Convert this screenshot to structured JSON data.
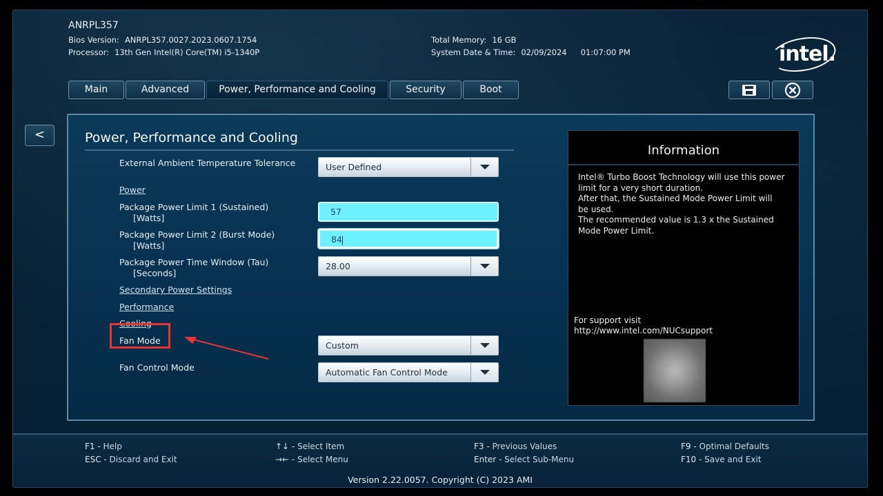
{
  "header": {
    "model": "ANRPL357",
    "bios_version_label": "Bios Version:",
    "bios_version": "ANRPL357.0027.2023.0607.1754",
    "processor_label": "Processor:",
    "processor": "13th Gen Intel(R) Core(TM) i5-1340P",
    "total_memory_label": "Total Memory:",
    "total_memory": "16 GB",
    "datetime_label": "System Date & Time:",
    "date": "02/09/2024",
    "time": "01:07:00 PM",
    "logo_text": "intel."
  },
  "tabs": [
    {
      "label": "Main"
    },
    {
      "label": "Advanced"
    },
    {
      "label": "Power, Performance and Cooling"
    },
    {
      "label": "Security"
    },
    {
      "label": "Boot"
    }
  ],
  "back_label": "<",
  "panel": {
    "title": "Power, Performance and Cooling",
    "ambient_label": "External Ambient Temperature Tolerance",
    "ambient_value": "User Defined",
    "power_link": "Power",
    "pl1_label": "Package Power Limit 1 (Sustained)",
    "pl1_unit": "[Watts]",
    "pl1_value": "57",
    "pl2_label": "Package Power Limit 2 (Burst Mode)",
    "pl2_unit": "[Watts]",
    "pl2_value": "84",
    "tau_label": "Package Power Time Window (Tau)",
    "tau_unit": "[Seconds]",
    "tau_value": "28.00",
    "secondary_link": "Secondary Power Settings",
    "performance_link": "Performance",
    "cooling_link": "Cooling",
    "fan_mode_label": "Fan Mode",
    "fan_mode_value": "Custom",
    "fan_control_label": "Fan Control Mode",
    "fan_control_value": "Automatic Fan Control Mode"
  },
  "info": {
    "title": "Information",
    "line1": "Intel® Turbo Boost Technology will use this power limit for a very short duration.",
    "line2": "After that, the Sustained Mode Power Limit will be used.",
    "line3": "The recommended value is 1.3 x the Sustained Mode Power Limit.",
    "support_line1": "For support visit",
    "support_line2": "http://www.intel.com/NUCsupport"
  },
  "footer": {
    "f1": "F1 - ",
    "f1_desc": "Help",
    "esc": "ESC - ",
    "esc_desc": "Discard and Exit",
    "arrows_ud": "↑↓ - ",
    "arrows_ud_desc": "Select Item",
    "arrows_lr": "→← - ",
    "arrows_lr_desc": "Select Menu",
    "f3": "F3 - ",
    "f3_desc": "Previous Values",
    "enter": "Enter - ",
    "enter_desc": "Select Sub-Menu",
    "f9": "F9 - ",
    "f9_desc": "Optimal Defaults",
    "f10": "F10 - ",
    "f10_desc": "Save and Exit",
    "version": "Version 2.22.0057. Copyright (C) 2023 AMI"
  },
  "colors": {
    "highlight_box": "#e43434",
    "input_fill": "#6ff0ff",
    "panel_border": "#5d8aa6"
  }
}
